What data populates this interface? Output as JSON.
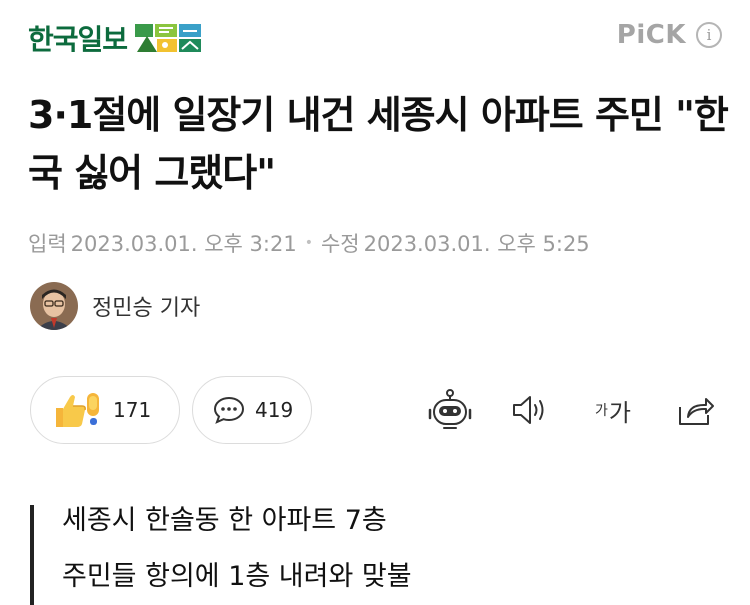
{
  "header": {
    "brand_name": "한국일보",
    "brand_logo_icon": "landscape-mosaic-icon",
    "pick_label": "PiCK",
    "info_symbol": "i",
    "brand_color": "#0c6b3d"
  },
  "article": {
    "headline": "3·1절에 일장기 내건 세종시 아파트 주민 \"한국 싫어 그랬다\"",
    "published_label": "입력",
    "published_at": "2023.03.01. 오후 3:21",
    "modified_label": "수정",
    "modified_at": "2023.03.01. 오후 5:25",
    "reporter_name": "정민승 기자"
  },
  "actions": {
    "reaction_icon": "thumbs-up-exclaim-icon",
    "reaction_count": "171",
    "comment_icon": "speech-bubble-icon",
    "comment_count": "419",
    "summary_icon": "robot-icon",
    "tts_icon": "speaker-icon",
    "font_size_small": "가",
    "font_size_large": "가",
    "share_icon": "share-icon"
  },
  "quote": {
    "lines": [
      "세종시 한솔동 한 아파트 7층",
      "주민들 항의에 1층 내려와 맞불"
    ]
  }
}
